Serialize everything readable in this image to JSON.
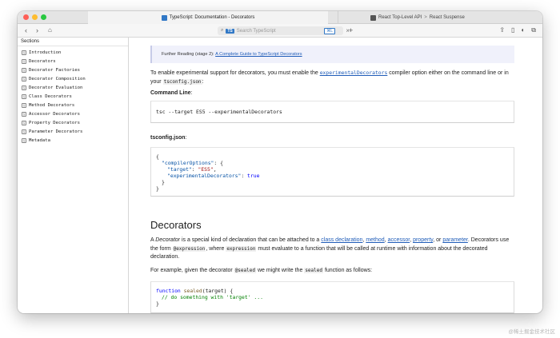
{
  "window": {
    "active_tab_title": "TypeScript: Documentation - Decorators",
    "inactive_tab_part1": "React Top-Level API",
    "inactive_tab_sep": ">",
    "inactive_tab_part2": "React Suspense"
  },
  "toolbar": {
    "search_placeholder": "Search TypeScript",
    "shortcut": "⌘L",
    "ts_badge": "TS"
  },
  "sidebar": {
    "title": "Sections",
    "items": [
      {
        "label": "Introduction"
      },
      {
        "label": "Decorators"
      },
      {
        "label": "Decorator Factories"
      },
      {
        "label": "Decorator Composition"
      },
      {
        "label": "Decorator Evaluation"
      },
      {
        "label": "Class Decorators"
      },
      {
        "label": "Method Decorators"
      },
      {
        "label": "Accessor Decorators"
      },
      {
        "label": "Property Decorators"
      },
      {
        "label": "Parameter Decorators"
      },
      {
        "label": "Metadata"
      }
    ]
  },
  "content": {
    "further_prefix": "Further Reading (stage 2):",
    "further_link": "A Complete Guide to TypeScript Decorators",
    "enable_1": "To enable experimental support for decorators, you must enable the",
    "enable_option": "experimentalDecorators",
    "enable_2": "compiler option either on the command line or in your",
    "enable_file": "tsconfig.json",
    "enable_3": ":",
    "cmd_label": "Command Line",
    "cmd_label_colon": ":",
    "cmd_code": "tsc --target ES5 --experimentalDecorators",
    "tsconfig_label": "tsconfig.json",
    "tsconfig_colon": ":",
    "json_line1": "{",
    "json_key1": "\"compilerOptions\"",
    "json_line2_rest": ": {",
    "json_key2": "\"target\"",
    "json_val2": "\"ES5\"",
    "json_key3": "\"experimentalDecorators\"",
    "json_val3": "true",
    "json_close_inner": "}",
    "json_close": "}",
    "section_heading": "Decorators",
    "def_1": "A",
    "def_decorator": "Decorator",
    "def_2": "is a special kind of declaration that can be attached to a",
    "link_class": "class declaration",
    "link_method": "method",
    "link_accessor": "accessor",
    "link_property": "property",
    "def_or": "or",
    "link_parameter": "parameter",
    "def_3": "Decorators use the form",
    "def_expr": "@expression",
    "def_4": ", where",
    "def_expr2": "expression",
    "def_5": "must evaluate to a function that will be called at runtime with information about the decorated declaration.",
    "example_1": "For example, given the decorator",
    "example_sealed_at": "@sealed",
    "example_2": "we might write the",
    "example_sealed": "sealed",
    "example_3": "function as follows:",
    "fn_keyword": "function",
    "fn_name": "sealed",
    "fn_sig": "(target) {",
    "fn_comment": "// do something with 'target' ...",
    "fn_close": "}"
  },
  "watermark": "@稀土掘金技术社区",
  "colors": {
    "link": "#1f5cb8",
    "ts_blue": "#3178c6",
    "traffic_red": "#fe5f57",
    "traffic_yellow": "#febc2e",
    "traffic_green": "#28c840"
  }
}
